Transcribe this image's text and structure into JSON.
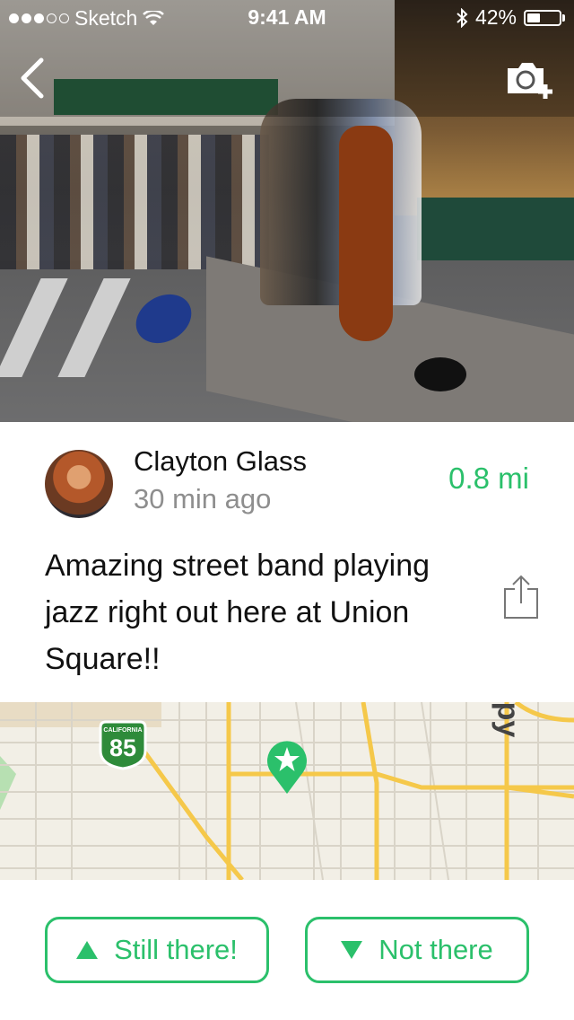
{
  "status_bar": {
    "carrier": "Sketch",
    "time": "9:41 AM",
    "battery_percent_label": "42%",
    "battery_level": 0.42,
    "signal_dots_filled": 3,
    "signal_dots_total": 5
  },
  "nav": {
    "back_icon": "chevron-left-icon",
    "camera_icon": "camera-add-icon"
  },
  "post": {
    "author_name": "Clayton Glass",
    "time_ago": "30 min ago",
    "distance": "0.8 mi",
    "message": "Amazing street band playing jazz right out here at Union Square!!",
    "share_icon": "share-icon"
  },
  "map": {
    "highway_shield_top": "CALIFORNIA",
    "highway_number": "85",
    "street_fragment": "py",
    "pin_icon": "star-pin-icon"
  },
  "actions": {
    "still_there_label": "Still there!",
    "not_there_label": "Not there"
  },
  "colors": {
    "accent_green": "#2bc06b",
    "secondary_text": "#8e8e8e",
    "map_bg": "#f2efe6",
    "map_main_road": "#f5c84a"
  }
}
